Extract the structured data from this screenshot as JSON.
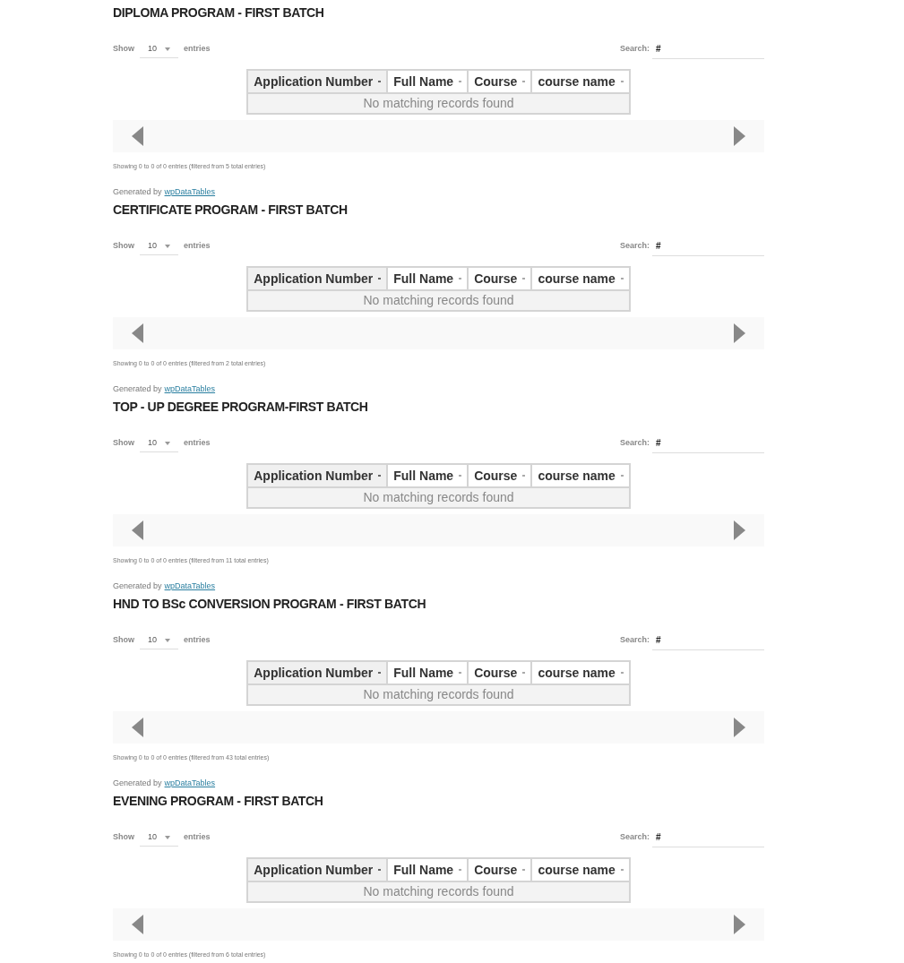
{
  "sections": [
    {
      "title": "DIPLOMA PROGRAM - FIRST BATCH",
      "show_label": "Show",
      "page_length": "10",
      "entries_label": "entries",
      "search_label": "Search:",
      "search_value": "#",
      "columns": [
        {
          "label": "Application Number",
          "sorted": true
        },
        {
          "label": "Full Name",
          "sorted": false
        },
        {
          "label": "Course",
          "sorted": false
        },
        {
          "label": "course name",
          "sorted": false
        }
      ],
      "empty_message": "No matching records found",
      "info": "Showing 0 to 0 of 0 entries (filtered from 5 total entries)",
      "footer": {
        "prefix": "Generated by",
        "link": "wpDataTables"
      }
    },
    {
      "title": "CERTIFICATE PROGRAM - FIRST BATCH",
      "show_label": "Show",
      "page_length": "10",
      "entries_label": "entries",
      "search_label": "Search:",
      "search_value": "#",
      "columns": [
        {
          "label": "Application Number",
          "sorted": true
        },
        {
          "label": "Full Name",
          "sorted": false
        },
        {
          "label": "Course",
          "sorted": false
        },
        {
          "label": "course name",
          "sorted": false
        }
      ],
      "empty_message": "No matching records found",
      "info": "Showing 0 to 0 of 0 entries (filtered from 2 total entries)",
      "footer": {
        "prefix": "Generated by",
        "link": "wpDataTables"
      }
    },
    {
      "title": "TOP - UP DEGREE PROGRAM-FIRST BATCH",
      "show_label": "Show",
      "page_length": "10",
      "entries_label": "entries",
      "search_label": "Search:",
      "search_value": "#",
      "columns": [
        {
          "label": "Application Number",
          "sorted": true
        },
        {
          "label": "Full Name",
          "sorted": false
        },
        {
          "label": "Course",
          "sorted": false
        },
        {
          "label": "course name",
          "sorted": false
        }
      ],
      "empty_message": "No matching records found",
      "info": "Showing 0 to 0 of 0 entries (filtered from 11 total entries)",
      "footer": {
        "prefix": "Generated by",
        "link": "wpDataTables"
      }
    },
    {
      "title": "HND TO BSc CONVERSION PROGRAM - FIRST BATCH",
      "show_label": "Show",
      "page_length": "10",
      "entries_label": "entries",
      "search_label": "Search:",
      "search_value": "#",
      "columns": [
        {
          "label": "Application Number",
          "sorted": true
        },
        {
          "label": "Full Name",
          "sorted": false
        },
        {
          "label": "Course",
          "sorted": false
        },
        {
          "label": "course name",
          "sorted": false
        }
      ],
      "empty_message": "No matching records found",
      "info": "Showing 0 to 0 of 0 entries (filtered from 43 total entries)",
      "footer": {
        "prefix": "Generated by",
        "link": "wpDataTables"
      }
    },
    {
      "title": "EVENING PROGRAM - FIRST BATCH",
      "show_label": "Show",
      "page_length": "10",
      "entries_label": "entries",
      "search_label": "Search:",
      "search_value": "#",
      "columns": [
        {
          "label": "Application Number",
          "sorted": true
        },
        {
          "label": "Full Name",
          "sorted": false
        },
        {
          "label": "Course",
          "sorted": false
        },
        {
          "label": "course name",
          "sorted": false
        }
      ],
      "empty_message": "No matching records found",
      "info": "Showing 0 to 0 of 0 entries (filtered from 6 total entries)"
    }
  ]
}
